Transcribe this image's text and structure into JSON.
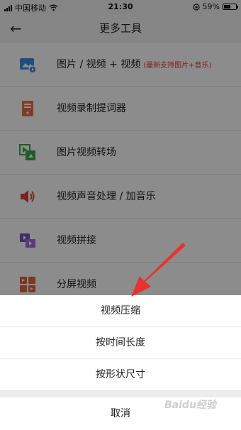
{
  "status_bar": {
    "carrier": "中国移动",
    "time": "21:30",
    "battery": "59%",
    "battery_level": 0.59,
    "icons": [
      "signal-icon",
      "wifi-icon",
      "orientation-lock-icon",
      "battery-icon"
    ]
  },
  "header": {
    "back_icon": "arrow-left-icon",
    "title": "更多工具"
  },
  "tools": [
    {
      "label": "图片 / 视频 + 视频",
      "note": "(最新支持图片+音乐)",
      "icon": "image-video-icon",
      "color": "#3a8ee6"
    },
    {
      "label": "视频录制提词器",
      "note": "",
      "icon": "teleprompter-icon",
      "color": "#e8704a"
    },
    {
      "label": "图片视频转场",
      "note": "",
      "icon": "transition-icon",
      "color": "#3aa64f"
    },
    {
      "label": "视频声音处理 / 加音乐",
      "note": "",
      "icon": "speaker-icon",
      "color": "#e23c3c"
    },
    {
      "label": "视频拼接",
      "note": "",
      "icon": "video-merge-icon",
      "color": "#7b4fc6"
    },
    {
      "label": "分屏视频",
      "note": "",
      "icon": "split-screen-icon",
      "color": "#e0653a"
    }
  ],
  "action_sheet": {
    "options": [
      "视频压缩",
      "按时间长度",
      "按形状尺寸"
    ],
    "cancel": "取消"
  },
  "annotation": {
    "icon": "red-arrow-annotation-icon",
    "color": "#e8322e"
  },
  "watermark": "Baidu经验"
}
